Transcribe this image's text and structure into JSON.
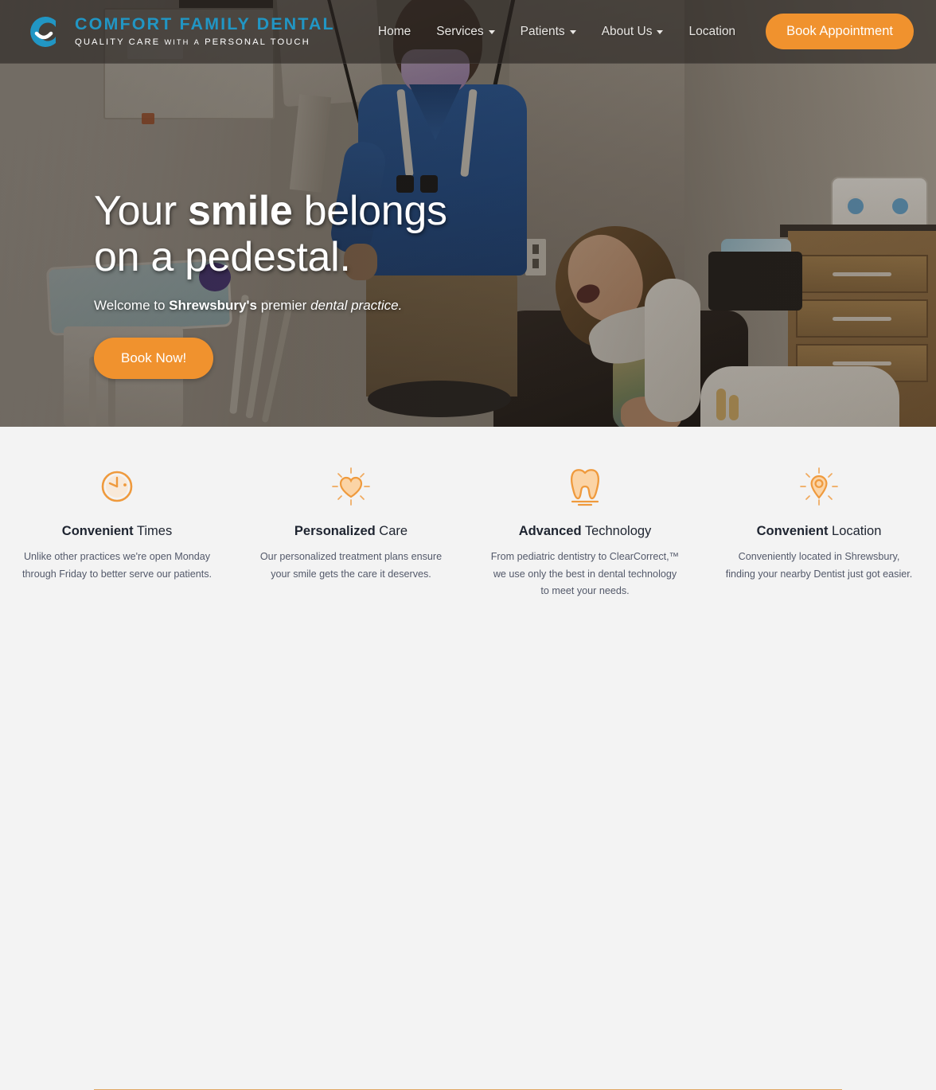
{
  "header": {
    "logo": {
      "icon": "c-smile-logo-icon",
      "brand": "COMFORT FAMILY DENTAL",
      "tagline_parts": [
        "QUALITY CARE",
        "WITH",
        "A",
        "PERSONAL TOUCH"
      ],
      "tagline_full": "QUALITY CARE WITH A PERSONAL TOUCH",
      "brand_color": "#2196c4"
    },
    "nav": [
      {
        "label": "Home",
        "has_dropdown": false
      },
      {
        "label": "Services",
        "has_dropdown": true
      },
      {
        "label": "Patients",
        "has_dropdown": true
      },
      {
        "label": "About Us",
        "has_dropdown": true
      },
      {
        "label": "Location",
        "has_dropdown": false
      }
    ],
    "cta": {
      "label": "Book Appointment",
      "color": "#f0922e"
    }
  },
  "hero": {
    "heading_1": "Your ",
    "heading_bold": "smile",
    "heading_2": " belongs",
    "heading_line2": "on a pedestal.",
    "sub_1": "Welcome to ",
    "sub_bold": "Shrewsbury's",
    "sub_2": " premier ",
    "sub_italic": "dental practice.",
    "cta": {
      "label": "Book Now!",
      "color": "#f0922e"
    }
  },
  "features": [
    {
      "icon": "clock-icon",
      "title_bold": "Convenient",
      "title_rest": " Times",
      "description": "Unlike other practices we're open Monday through Friday to better serve our patients."
    },
    {
      "icon": "radiating-heart-icon",
      "title_bold": "Personalized",
      "title_rest": " Care",
      "description": "Our personalized treatment plans ensure your smile gets the care it deserves."
    },
    {
      "icon": "tooth-icon",
      "title_bold": "Advanced",
      "title_rest": " Technology",
      "description": "From pediatric dentistry to ClearCorrect,™ we use only the best in dental technology to meet your needs."
    },
    {
      "icon": "radiating-map-pin-icon",
      "title_bold": "Convenient",
      "title_rest": " Location",
      "description": "Conveniently located in Shrewsbury, finding your nearby Dentist just got easier."
    }
  ],
  "colors": {
    "accent_orange": "#f0922e",
    "icon_orange": "#ef9a3d",
    "brand_blue": "#2196c4",
    "section_bg": "#f3f3f3",
    "divider": "#e0a862",
    "heading_dark": "#1e2430"
  }
}
